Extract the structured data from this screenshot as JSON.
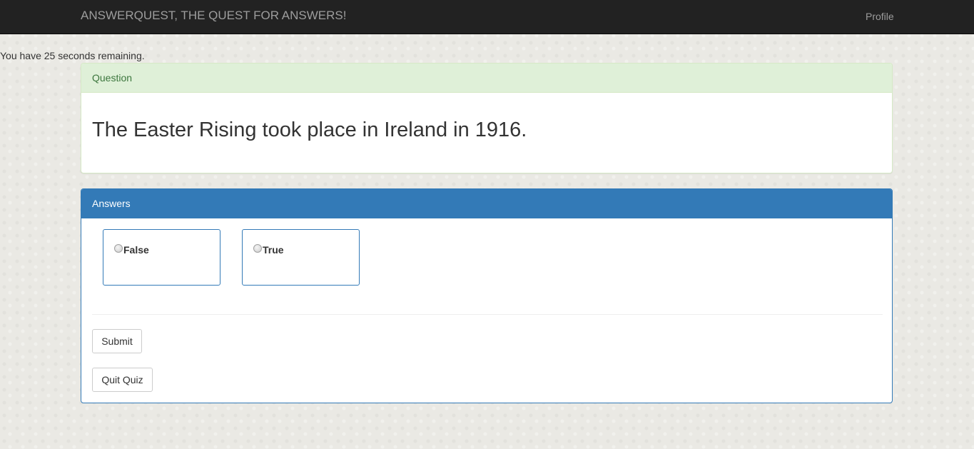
{
  "navbar": {
    "brand": "ANSWERQUEST, THE QUEST FOR ANSWERS!",
    "profile_link": "Profile"
  },
  "timer": {
    "text": "You have 25 seconds remaining."
  },
  "question_panel": {
    "heading": "Question",
    "text": "The Easter Rising took place in Ireland in 1916."
  },
  "answers_panel": {
    "heading": "Answers",
    "options": [
      {
        "label": "False",
        "selected": false
      },
      {
        "label": "True",
        "selected": false
      }
    ],
    "submit_label": "Submit",
    "quit_label": "Quit Quiz"
  },
  "colors": {
    "navbar_bg": "#222222",
    "question_heading_bg": "#dff0d8",
    "question_heading_text": "#3c763d",
    "answers_heading_bg": "#337ab7",
    "page_bg": "#eae9e4"
  }
}
